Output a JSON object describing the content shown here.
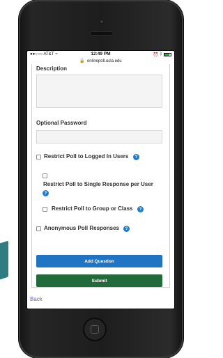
{
  "status_bar": {
    "carrier": "●●○○○ AT&T",
    "wifi": "≈",
    "time": "12:49 PM",
    "battery_fill_percent": 82
  },
  "browser": {
    "url": "onlinepoll.ucla.edu"
  },
  "form": {
    "description_label": "Description",
    "password_label": "Optional Password",
    "options": [
      "Restrict Poll to Logged In Users",
      "Restrict Poll to Single Response per User",
      "Restrict Poll to Group or Class",
      "Anonymous Poll Responses"
    ],
    "add_question_label": "Add Question",
    "submit_label": "Submit",
    "back_label": "Back"
  },
  "colors": {
    "primary_button": "#1f74c3",
    "submit_button": "#216b3a",
    "help_icon": "#1f7ed0",
    "back_link": "#7a5dc8"
  },
  "icons": {
    "help": "question-mark-circle",
    "lock": "lock"
  }
}
